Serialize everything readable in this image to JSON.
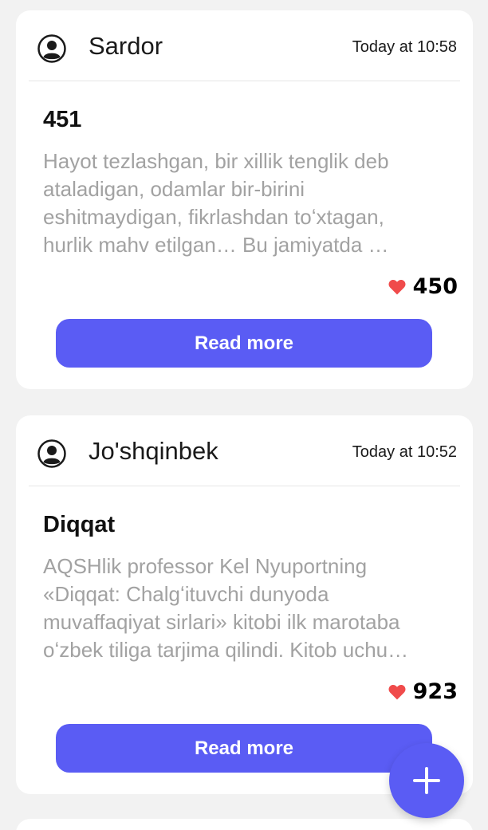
{
  "colors": {
    "accent": "#5a5cf4",
    "heart": "#f04b4b",
    "excerpt_text": "#a2a2a2"
  },
  "posts": [
    {
      "author": "Sardor",
      "time": "Today at 10:58",
      "title": "451",
      "excerpt_lines": [
        "Hayot tezlashgan, bir xillik tenglik deb",
        "ataladigan, odamlar bir-birini",
        "eshitmaydigan, fikrlashdan toʻxtagan,",
        "hurlik mahv etilgan…  Bu jamiyatda …"
      ],
      "likes": "450",
      "read_more_label": "Read more",
      "avatar_icon": "user-avatar-icon",
      "like_icon": "heart-icon"
    },
    {
      "author": "Jo'shqinbek",
      "time": "Today at 10:52",
      "title": "Diqqat",
      "excerpt_lines": [
        "AQSHlik professor Kel Nyuportning",
        "«Diqqat: Chalgʻituvchi dunyoda",
        "muvaffaqiyat sirlari» kitobi ilk marotaba",
        "oʻzbek tiliga tarjima qilindi. Kitob uchu…"
      ],
      "likes": "923",
      "read_more_label": "Read more",
      "avatar_icon": "user-avatar-icon",
      "like_icon": "heart-icon"
    }
  ],
  "fab": {
    "icon": "plus-icon"
  }
}
